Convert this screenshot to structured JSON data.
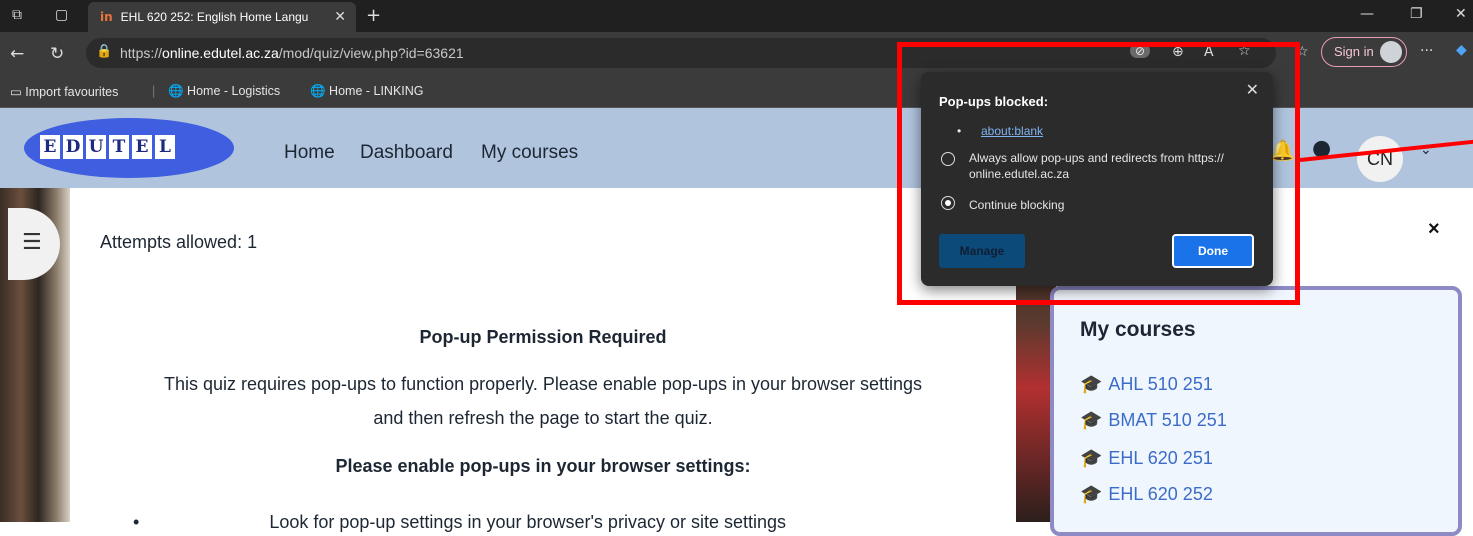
{
  "browser": {
    "tab_title": "EHL 620 252: English Home Langu",
    "tab_favicon": "in",
    "url_prefix": "https://",
    "url_host": "online.edutel.ac.za",
    "url_path": "/mod/quiz/view.php?id=63621",
    "sign_in_label": "Sign in",
    "favourites": [
      "Import favourites",
      "Home - Logistics",
      "Home - LINKING"
    ]
  },
  "header": {
    "logo_letters": [
      "E",
      "D",
      "U",
      "T",
      "E",
      "L"
    ],
    "nav": [
      "Home",
      "Dashboard",
      "My courses"
    ],
    "user_initials": "CN"
  },
  "main": {
    "attempts": "Attempts allowed: 1",
    "heading": "Pop-up Permission Required",
    "description_line1": "This quiz requires pop-ups to function properly. Please enable pop-ups in your browser settings",
    "description_line2": "and then refresh the page to start the quiz.",
    "subheading": "Please enable pop-ups in your browser settings:",
    "bullet_partial": "Look for pop-up settings in your browser's privacy or site settings"
  },
  "sidebar": {
    "close_label": "×",
    "heading": "My courses",
    "courses": [
      "AHL 510 251",
      "BMAT 510 251",
      "EHL 620 251",
      "EHL 620 252"
    ]
  },
  "popup": {
    "title": "Pop-ups blocked:",
    "blocked_url": "about:blank",
    "option_allow_line1": "Always allow pop-ups and redirects from https://",
    "option_allow_line2": "online.edutel.ac.za",
    "option_block": "Continue blocking",
    "selected_option": "Continue blocking",
    "manage_label": "Manage",
    "done_label": "Done"
  },
  "colors": {
    "annotation": "#ff0000",
    "header_bg": "#b0c4de",
    "course_link": "#3c6cc9",
    "done_button": "#1a73e8"
  }
}
